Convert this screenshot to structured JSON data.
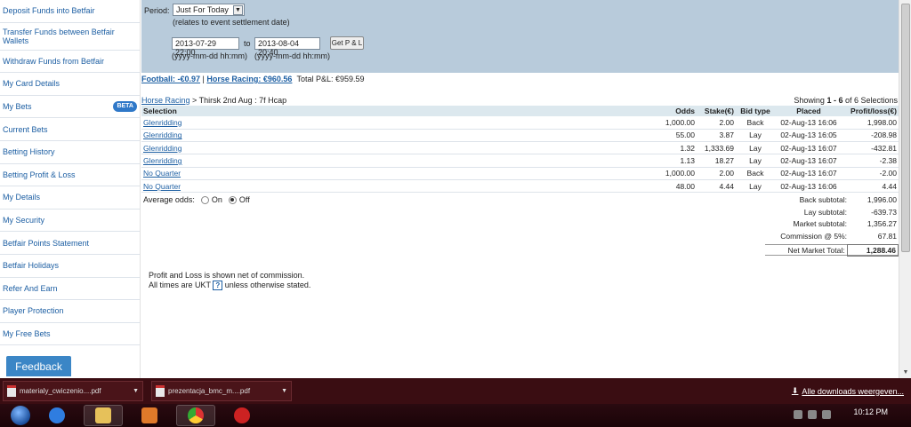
{
  "sidebar": {
    "items": [
      {
        "label": "Deposit Funds into Betfair"
      },
      {
        "label": "Transfer Funds between Betfair Wallets"
      },
      {
        "label": "Withdraw Funds from Betfair"
      },
      {
        "label": "My Card Details"
      },
      {
        "label": "My Bets",
        "badge": "BETA"
      },
      {
        "label": "Current Bets"
      },
      {
        "label": "Betting History"
      },
      {
        "label": "Betting Profit & Loss"
      },
      {
        "label": "My Details"
      },
      {
        "label": "My Security"
      },
      {
        "label": "Betfair Points Statement"
      },
      {
        "label": "Betfair Holidays"
      },
      {
        "label": "Refer And Earn"
      },
      {
        "label": "Player Protection"
      },
      {
        "label": "My Free Bets"
      }
    ],
    "feedback_label": "Feedback"
  },
  "period": {
    "label": "Period:",
    "selected": "Just For Today",
    "note": "(relates to event settlement date)",
    "from_value": "2013-07-29 22:00",
    "to_label": "to",
    "to_value": "2013-08-04 20:40",
    "button_label": "Get P & L",
    "from_hint": "(yyyy-mm-dd hh:mm)",
    "to_hint": "(yyyy-mm-dd hh:mm)"
  },
  "summary": {
    "football": "Football: -€0.97",
    "separator": "|",
    "horse_racing": "Horse Racing: €960.56",
    "total": "Total P&L:  €959.59"
  },
  "breadcrumb": {
    "root": "Horse Racing",
    "rest": " > Thirsk 2nd Aug : 7f Hcap"
  },
  "showing": {
    "prefix": "Showing ",
    "range": "1 - 6",
    "suffix": " of 6 Selections"
  },
  "table": {
    "headers": [
      "Selection",
      "Odds",
      "Stake(€)",
      "Bid type",
      "Placed",
      "Profit/loss(€)"
    ],
    "rows": [
      {
        "selection": "Glenridding",
        "odds": "1,000.00",
        "stake": "2.00",
        "bid": "Back",
        "placed": "02-Aug-13 16:06",
        "pl": "1,998.00"
      },
      {
        "selection": "Glenridding",
        "odds": "55.00",
        "stake": "3.87",
        "bid": "Lay",
        "placed": "02-Aug-13 16:05",
        "pl": "-208.98"
      },
      {
        "selection": "Glenridding",
        "odds": "1.32",
        "stake": "1,333.69",
        "bid": "Lay",
        "placed": "02-Aug-13 16:07",
        "pl": "-432.81"
      },
      {
        "selection": "Glenridding",
        "odds": "1.13",
        "stake": "18.27",
        "bid": "Lay",
        "placed": "02-Aug-13 16:07",
        "pl": "-2.38"
      },
      {
        "selection": "No Quarter",
        "odds": "1,000.00",
        "stake": "2.00",
        "bid": "Back",
        "placed": "02-Aug-13 16:07",
        "pl": "-2.00"
      },
      {
        "selection": "No Quarter",
        "odds": "48.00",
        "stake": "4.44",
        "bid": "Lay",
        "placed": "02-Aug-13 16:06",
        "pl": "4.44"
      }
    ]
  },
  "avg_odds": {
    "label": "Average odds:",
    "on_label": "On",
    "off_label": "Off",
    "selected": "Off"
  },
  "subtotals": {
    "back_label": "Back subtotal:",
    "back_value": "1,996.00",
    "lay_label": "Lay subtotal:",
    "lay_value": "-639.73",
    "market_label": "Market subtotal:",
    "market_value": "1,356.27",
    "commission_label": "Commission @ 5%:",
    "commission_value": "67.81",
    "net_label": "Net Market Total:",
    "net_value": "1,288.46"
  },
  "footnote": {
    "line1": "Profit and Loss is shown net of commission.",
    "line2_prefix": "All times are UKT",
    "help": "?",
    "line2_suffix": "unless otherwise stated."
  },
  "downloads": {
    "items": [
      {
        "name": "materialy_cwiczenio....pdf"
      },
      {
        "name": "prezentacja_bmc_m....pdf"
      }
    ],
    "show_all": "Alle downloads weergeven..."
  },
  "taskbar": {
    "time": "10:12 PM"
  }
}
